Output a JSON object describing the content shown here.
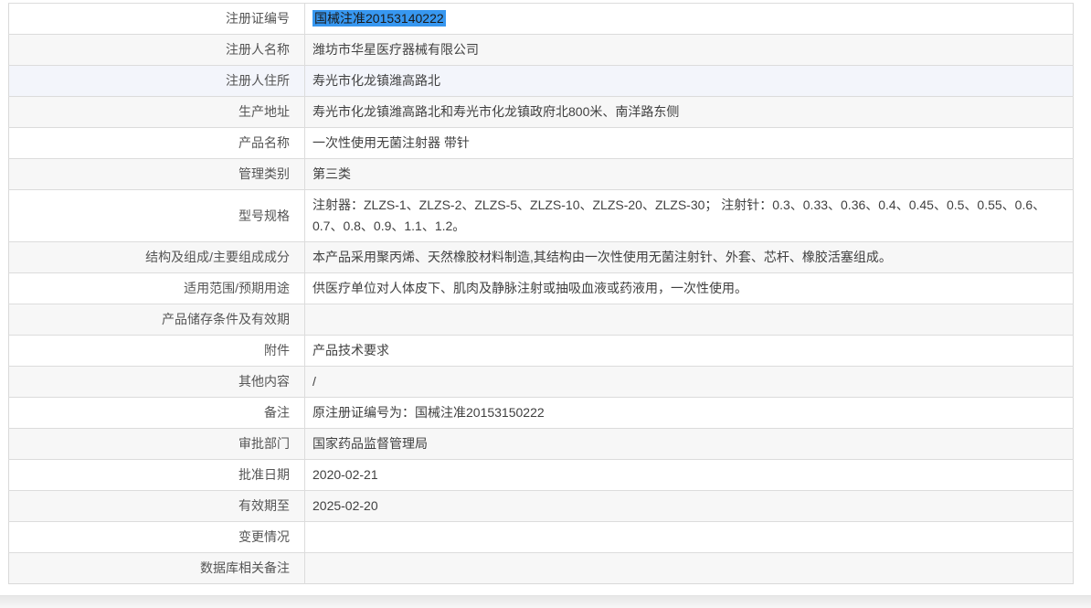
{
  "colors": {
    "row_stripe": "#f7f7f7",
    "row_hover": "#f3f5fb",
    "border": "#dcdcdc",
    "label_text": "#555555",
    "value_text": "#404040",
    "selection_background": "#3797f0",
    "selection_text": "#1a1a1a"
  },
  "table": {
    "rows": [
      {
        "label": "注册证编号",
        "value": "国械注准20153140222",
        "selected": true
      },
      {
        "label": "注册人名称",
        "value": "潍坊市华星医疗器械有限公司"
      },
      {
        "label": "注册人住所",
        "value": "寿光市化龙镇潍高路北",
        "hover": true
      },
      {
        "label": "生产地址",
        "value": "寿光市化龙镇潍高路北和寿光市化龙镇政府北800米、南洋路东侧"
      },
      {
        "label": "产品名称",
        "value": "一次性使用无菌注射器 带针"
      },
      {
        "label": "管理类别",
        "value": "第三类"
      },
      {
        "label": "型号规格",
        "value": "注射器：ZLZS-1、ZLZS-2、ZLZS-5、ZLZS-10、ZLZS-20、ZLZS-30； 注射针：0.3、0.33、0.36、0.4、0.45、0.5、0.55、0.6、0.7、0.8、0.9、1.1、1.2。",
        "tall": true
      },
      {
        "label": "结构及组成/主要组成成分",
        "value": "本产品采用聚丙烯、天然橡胶材料制造,其结构由一次性使用无菌注射针、外套、芯杆、橡胶活塞组成。"
      },
      {
        "label": "适用范围/预期用途",
        "value": "供医疗单位对人体皮下、肌肉及静脉注射或抽吸血液或药液用，一次性使用。"
      },
      {
        "label": "产品储存条件及有效期",
        "value": ""
      },
      {
        "label": "附件",
        "value": "产品技术要求"
      },
      {
        "label": "其他内容",
        "value": "/"
      },
      {
        "label": "备注",
        "value": "原注册证编号为：国械注准20153150222"
      },
      {
        "label": "审批部门",
        "value": "国家药品监督管理局"
      },
      {
        "label": "批准日期",
        "value": "2020-02-21"
      },
      {
        "label": "有效期至",
        "value": "2025-02-20"
      },
      {
        "label": "变更情况",
        "value": ""
      },
      {
        "label": "数据库相关备注",
        "value": ""
      }
    ]
  }
}
